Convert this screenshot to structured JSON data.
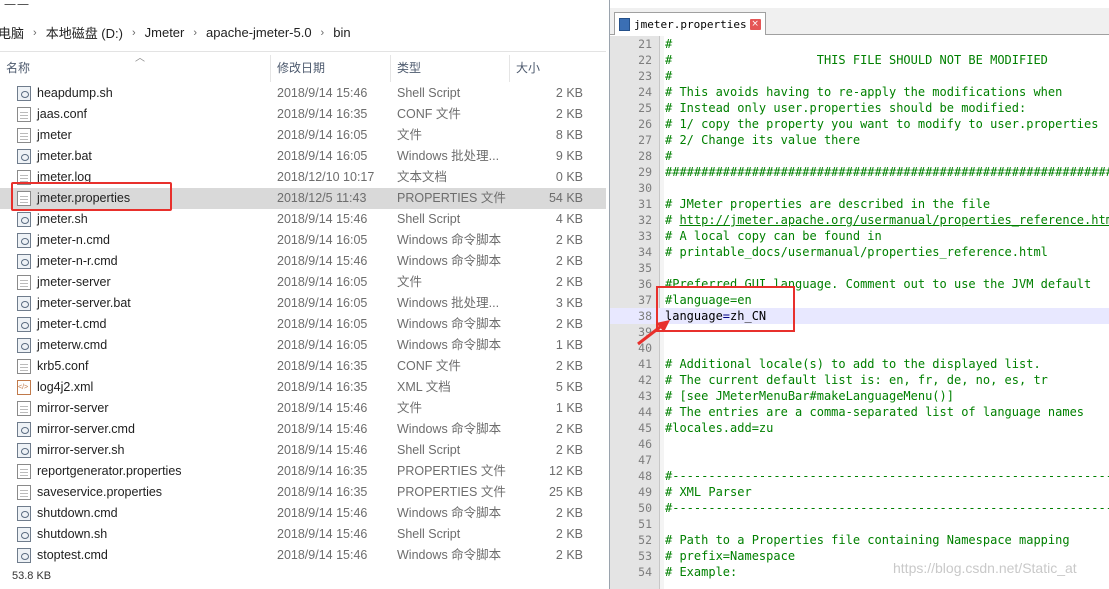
{
  "explorer": {
    "topstrip_text": "一一",
    "breadcrumb": [
      "电脑",
      "本地磁盘 (D:)",
      "Jmeter",
      "apache-jmeter-5.0",
      "bin"
    ],
    "columns": {
      "name": "名称",
      "date": "修改日期",
      "type": "类型",
      "size": "大小"
    },
    "files": [
      {
        "name": "heapdump.sh",
        "date": "2018/9/14 15:46",
        "type": "Shell Script",
        "size": "2 KB",
        "icon": "script-icon"
      },
      {
        "name": "jaas.conf",
        "date": "2018/9/14 16:35",
        "type": "CONF 文件",
        "size": "2 KB",
        "icon": "file-icon"
      },
      {
        "name": "jmeter",
        "date": "2018/9/14 16:05",
        "type": "文件",
        "size": "8 KB",
        "icon": "file-icon"
      },
      {
        "name": "jmeter.bat",
        "date": "2018/9/14 16:05",
        "type": "Windows 批处理...",
        "size": "9 KB",
        "icon": "script-icon"
      },
      {
        "name": "jmeter.log",
        "date": "2018/12/10 10:17",
        "type": "文本文档",
        "size": "0 KB",
        "icon": "document-icon"
      },
      {
        "name": "jmeter.properties",
        "date": "2018/12/5 11:43",
        "type": "PROPERTIES 文件",
        "size": "54 KB",
        "icon": "file-icon",
        "selected": true
      },
      {
        "name": "jmeter.sh",
        "date": "2018/9/14 15:46",
        "type": "Shell Script",
        "size": "4 KB",
        "icon": "script-icon"
      },
      {
        "name": "jmeter-n.cmd",
        "date": "2018/9/14 16:05",
        "type": "Windows 命令脚本",
        "size": "2 KB",
        "icon": "script-icon"
      },
      {
        "name": "jmeter-n-r.cmd",
        "date": "2018/9/14 15:46",
        "type": "Windows 命令脚本",
        "size": "2 KB",
        "icon": "script-icon"
      },
      {
        "name": "jmeter-server",
        "date": "2018/9/14 16:05",
        "type": "文件",
        "size": "2 KB",
        "icon": "file-icon"
      },
      {
        "name": "jmeter-server.bat",
        "date": "2018/9/14 16:05",
        "type": "Windows 批处理...",
        "size": "3 KB",
        "icon": "script-icon"
      },
      {
        "name": "jmeter-t.cmd",
        "date": "2018/9/14 16:05",
        "type": "Windows 命令脚本",
        "size": "2 KB",
        "icon": "script-icon"
      },
      {
        "name": "jmeterw.cmd",
        "date": "2018/9/14 16:05",
        "type": "Windows 命令脚本",
        "size": "1 KB",
        "icon": "script-icon"
      },
      {
        "name": "krb5.conf",
        "date": "2018/9/14 16:35",
        "type": "CONF 文件",
        "size": "2 KB",
        "icon": "file-icon"
      },
      {
        "name": "log4j2.xml",
        "date": "2018/9/14 16:35",
        "type": "XML 文档",
        "size": "5 KB",
        "icon": "xml-icon"
      },
      {
        "name": "mirror-server",
        "date": "2018/9/14 15:46",
        "type": "文件",
        "size": "1 KB",
        "icon": "file-icon"
      },
      {
        "name": "mirror-server.cmd",
        "date": "2018/9/14 15:46",
        "type": "Windows 命令脚本",
        "size": "2 KB",
        "icon": "script-icon"
      },
      {
        "name": "mirror-server.sh",
        "date": "2018/9/14 15:46",
        "type": "Shell Script",
        "size": "2 KB",
        "icon": "script-icon"
      },
      {
        "name": "reportgenerator.properties",
        "date": "2018/9/14 16:35",
        "type": "PROPERTIES 文件",
        "size": "12 KB",
        "icon": "file-icon"
      },
      {
        "name": "saveservice.properties",
        "date": "2018/9/14 16:35",
        "type": "PROPERTIES 文件",
        "size": "25 KB",
        "icon": "file-icon"
      },
      {
        "name": "shutdown.cmd",
        "date": "2018/9/14 15:46",
        "type": "Windows 命令脚本",
        "size": "2 KB",
        "icon": "script-icon"
      },
      {
        "name": "shutdown.sh",
        "date": "2018/9/14 15:46",
        "type": "Shell Script",
        "size": "2 KB",
        "icon": "script-icon"
      },
      {
        "name": "stoptest.cmd",
        "date": "2018/9/14 15:46",
        "type": "Windows 命令脚本",
        "size": "2 KB",
        "icon": "script-icon"
      }
    ],
    "status_text": "53.8 KB"
  },
  "editor": {
    "tab_title": "jmeter.properties",
    "current_line": "38",
    "lines": [
      {
        "n": "21",
        "t": "#"
      },
      {
        "n": "22",
        "t": "#                    THIS FILE SHOULD NOT BE MODIFIED"
      },
      {
        "n": "23",
        "t": "#"
      },
      {
        "n": "24",
        "t": "# This avoids having to re-apply the modifications when"
      },
      {
        "n": "25",
        "t": "# Instead only user.properties should be modified:"
      },
      {
        "n": "26",
        "t": "# 1/ copy the property you want to modify to user.properties"
      },
      {
        "n": "27",
        "t": "# 2/ Change its value there"
      },
      {
        "n": "28",
        "t": "#"
      },
      {
        "n": "29",
        "t": "################################################################"
      },
      {
        "n": "30",
        "t": ""
      },
      {
        "n": "31",
        "t": "# JMeter properties are described in the file"
      },
      {
        "n": "32",
        "t": "# http://jmeter.apache.org/usermanual/properties_reference.html"
      },
      {
        "n": "33",
        "t": "# A local copy can be found in"
      },
      {
        "n": "34",
        "t": "# printable_docs/usermanual/properties_reference.html"
      },
      {
        "n": "35",
        "t": ""
      },
      {
        "n": "36",
        "t": "#Preferred GUI language. Comment out to use the JVM default"
      },
      {
        "n": "37",
        "t": "#language=en"
      },
      {
        "n": "38",
        "t": "language=zh_CN"
      },
      {
        "n": "39",
        "t": ""
      },
      {
        "n": "40",
        "t": ""
      },
      {
        "n": "41",
        "t": "# Additional locale(s) to add to the displayed list."
      },
      {
        "n": "42",
        "t": "# The current default list is: en, fr, de, no, es, tr"
      },
      {
        "n": "43",
        "t": "# [see JMeterMenuBar#makeLanguageMenu()]"
      },
      {
        "n": "44",
        "t": "# The entries are a comma-separated list of language names"
      },
      {
        "n": "45",
        "t": "#locales.add=zu"
      },
      {
        "n": "46",
        "t": ""
      },
      {
        "n": "47",
        "t": ""
      },
      {
        "n": "48",
        "t": "#---------------------------------------------------------------"
      },
      {
        "n": "49",
        "t": "# XML Parser"
      },
      {
        "n": "50",
        "t": "#---------------------------------------------------------------"
      },
      {
        "n": "51",
        "t": ""
      },
      {
        "n": "52",
        "t": "# Path to a Properties file containing Namespace mapping"
      },
      {
        "n": "53",
        "t": "# prefix=Namespace"
      },
      {
        "n": "54",
        "t": "# Example:"
      }
    ]
  },
  "watermark": "https://blog.csdn.net/Static_at",
  "colors": {
    "highlight_red": "#e8302c",
    "comment_green": "#008000",
    "current_line_bg": "#e8e8ff"
  }
}
